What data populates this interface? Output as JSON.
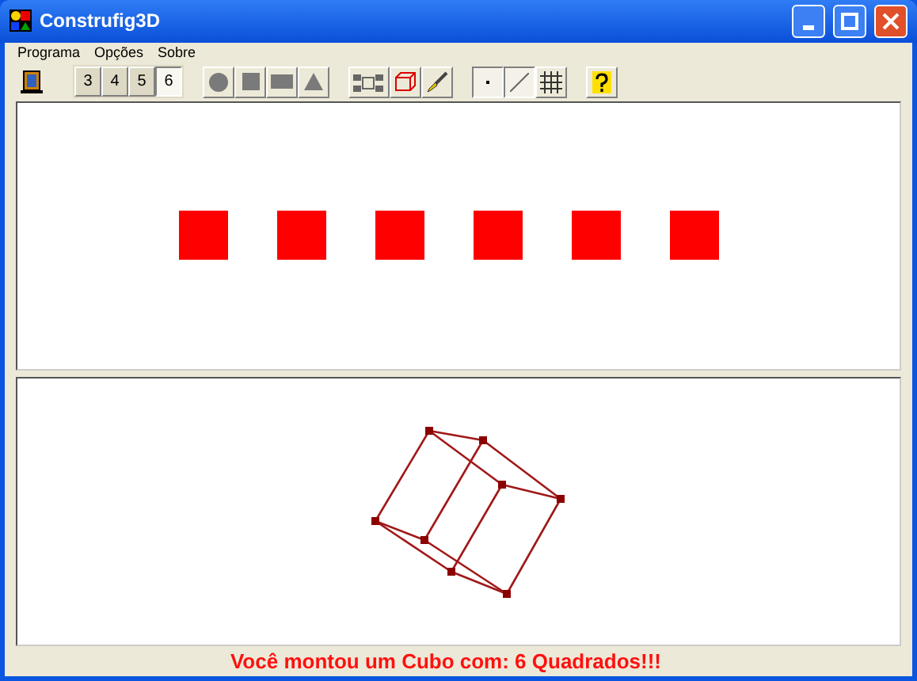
{
  "window": {
    "title": "Construfig3D"
  },
  "menu": [
    "Programa",
    "Opções",
    "Sobre"
  ],
  "face_buttons": [
    {
      "label": "3",
      "selected": false
    },
    {
      "label": "4",
      "selected": false
    },
    {
      "label": "5",
      "selected": false
    },
    {
      "label": "6",
      "selected": true
    }
  ],
  "status": "Você montou um Cubo com: 6 Quadrados!!!"
}
